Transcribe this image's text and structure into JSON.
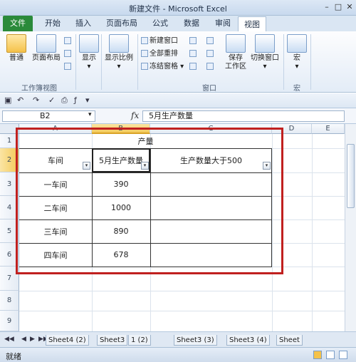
{
  "window": {
    "title": "新建文件 - Microsoft Excel",
    "min": "–",
    "max": "□",
    "close": "✕"
  },
  "tabs": [
    "文件",
    "开始",
    "插入",
    "页面布局",
    "公式",
    "数据",
    "审阅",
    "视图"
  ],
  "ribbon": {
    "normal": "普通",
    "page_layout": "页面布局",
    "show": "显示",
    "zoom": "显示比例",
    "new_window": "新建窗口",
    "arrange_all": "全部重排",
    "freeze_panes": "冻结窗格",
    "save_workspace": "保存\n工作区",
    "switch_windows": "切换窗口",
    "macros": "宏",
    "group_workbook_views": "工作簿视图",
    "group_window": "窗口",
    "group_macros": "宏"
  },
  "name_box": "B2",
  "fx_label": "fx",
  "formula_value": "5月生产数量",
  "columns": [
    "A",
    "B",
    "C",
    "D",
    "E"
  ],
  "rows": [
    "1",
    "2",
    "3",
    "4",
    "5",
    "6",
    "7",
    "8",
    "9"
  ],
  "table": {
    "title": "产量",
    "headers": [
      "车间",
      "5月生产数量",
      "生产数量大于500"
    ],
    "rows": [
      {
        "workshop": "一车间",
        "qty": "390"
      },
      {
        "workshop": "二车间",
        "qty": "1000"
      },
      {
        "workshop": "三车间",
        "qty": "890"
      },
      {
        "workshop": "四车间",
        "qty": "678"
      }
    ]
  },
  "sheets": [
    "Sheet4 (2)",
    "Sheet3",
    "1 (2)",
    "Sheet3 (3)",
    "Sheet3 (4)",
    "Sheet"
  ],
  "status": "就绪",
  "colors": {
    "file_tab": "#2a8a3a",
    "highlight_box": "#c0201f",
    "selected_header": "#f3c957"
  }
}
